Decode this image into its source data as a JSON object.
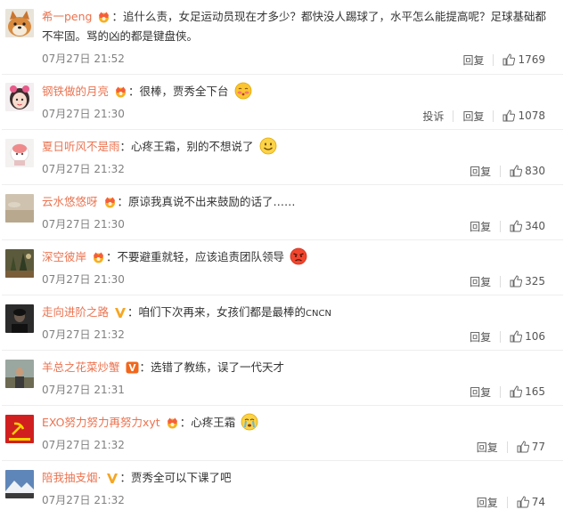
{
  "comments": [
    {
      "name": "希一peng",
      "badge": "crown",
      "text": "追什么责，女足运动员现在才多少？都快没人踢球了，水平怎么能提高呢？足球基础都 不牢固。骂的凶的都是键盘侠。",
      "date": "07月27日 21:52",
      "report": "",
      "reply": "回复",
      "likes": "1769",
      "avatar": "shiba-icon",
      "emoji": ""
    },
    {
      "name": "钢铁做的月亮",
      "badge": "crown",
      "text": "很棒，贾秀全下台",
      "date": "07月27日 21:30",
      "report": "投诉",
      "reply": "回复",
      "likes": "1078",
      "avatar": "girl-avatar-icon",
      "emoji": "blush-face-icon"
    },
    {
      "name": "夏日听风不是雨",
      "badge": "",
      "text": "心疼王霜，别的不想说了",
      "date": "07月27日 21:32",
      "report": "",
      "reply": "回复",
      "likes": "830",
      "avatar": "cartoon-avatar-icon",
      "emoji": "smile-face-icon"
    },
    {
      "name": "云水悠悠呀",
      "badge": "crown",
      "text": "原谅我真说不出来鼓励的话了……",
      "date": "07月27日 21:30",
      "report": "",
      "reply": "回复",
      "likes": "340",
      "avatar": "landscape-avatar-icon",
      "emoji": ""
    },
    {
      "name": "深空彼岸",
      "badge": "crown",
      "text": "不要避重就轻，应该追责团队领导",
      "date": "07月27日 21:30",
      "report": "",
      "reply": "回复",
      "likes": "325",
      "avatar": "forest-avatar-icon",
      "emoji": "angry-face-icon"
    },
    {
      "name": "走向进阶之路",
      "badge": "v-yellow",
      "text": "咱们下次再来，女孩们都是最棒的",
      "text_suffix": "CNCN",
      "date": "07月27日 21:32",
      "report": "",
      "reply": "回复",
      "likes": "106",
      "avatar": "portrait-avatar-icon",
      "emoji": ""
    },
    {
      "name": "羊总之花菜炒蟹",
      "badge": "v-orange",
      "text": "选错了教练，误了一代天才",
      "date": "07月27日 21:31",
      "report": "",
      "reply": "回复",
      "likes": "165",
      "avatar": "outdoor-avatar-icon",
      "emoji": ""
    },
    {
      "name": "EXO努力努力再努力xyt",
      "badge": "crown",
      "text": "心疼王霜",
      "date": "07月27日 21:32",
      "report": "",
      "reply": "回复",
      "likes": "77",
      "avatar": "red-flag-avatar-icon",
      "emoji": "crying-face-icon"
    },
    {
      "name": "陪我抽支烟·",
      "badge": "v-yellow",
      "text": "贾秀全可以下课了吧",
      "date": "07月27日 21:32",
      "report": "",
      "reply": "回复",
      "likes": "74",
      "avatar": "mountain-avatar-icon",
      "emoji": ""
    }
  ],
  "colors": {
    "name": "#eb7350",
    "date": "#808080",
    "text": "#333333",
    "divider": "#eeeeee"
  }
}
